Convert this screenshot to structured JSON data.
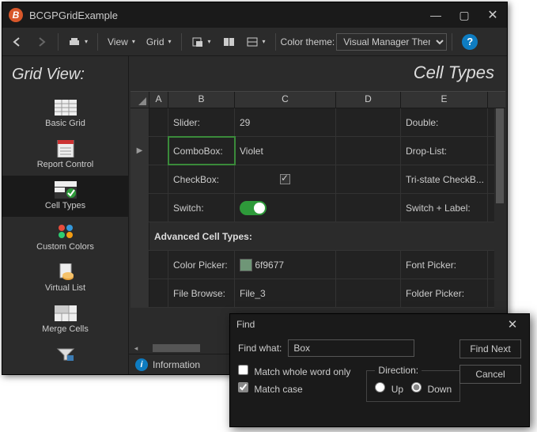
{
  "window": {
    "title": "BCGPGridExample"
  },
  "toolbar": {
    "view": "View",
    "grid": "Grid",
    "theme_label": "Color theme:",
    "theme_value": "Visual Manager Theme"
  },
  "sidebar": {
    "title": "Grid View:",
    "items": [
      {
        "label": "Basic Grid"
      },
      {
        "label": "Report Control"
      },
      {
        "label": "Cell Types"
      },
      {
        "label": "Custom Colors"
      },
      {
        "label": "Virtual List"
      },
      {
        "label": "Merge Cells"
      }
    ]
  },
  "main": {
    "title": "Cell Types",
    "columns": [
      "A",
      "B",
      "C",
      "D",
      "E"
    ],
    "rows": {
      "r1": {
        "b": "Slider:",
        "c": "29",
        "e": "Double:"
      },
      "r2": {
        "b": "ComboBox:",
        "c": "Violet",
        "e": "Drop-List:"
      },
      "r3": {
        "b": "CheckBox:",
        "e": "Tri-state CheckB..."
      },
      "r4": {
        "b": "Switch:",
        "e": "Switch + Label:"
      },
      "section": "Advanced Cell Types:",
      "r5": {
        "b": "Color Picker:",
        "c": "6f9677",
        "e": "Font Picker:"
      },
      "r6": {
        "b": "File Browse:",
        "c": "File_3",
        "e": "Folder Picker:"
      }
    }
  },
  "status": {
    "text": "Information"
  },
  "dialog": {
    "title": "Find",
    "find_what_label": "Find what:",
    "find_what_value": "Box",
    "match_word": "Match whole word only",
    "match_case": "Match case",
    "direction": "Direction:",
    "up": "Up",
    "down": "Down",
    "find_next": "Find Next",
    "cancel": "Cancel"
  }
}
